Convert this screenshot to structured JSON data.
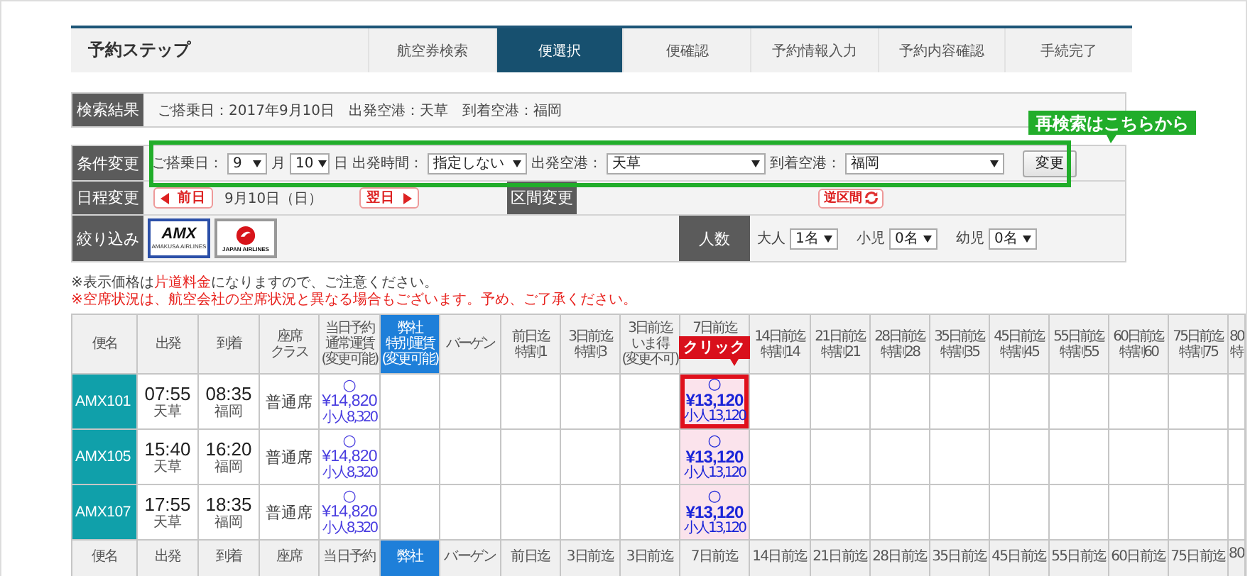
{
  "steps": {
    "title": "予約ステップ",
    "items": [
      {
        "label": "航空券検索",
        "selected": false
      },
      {
        "label": "便選択",
        "selected": true
      },
      {
        "label": "便確認",
        "selected": false
      },
      {
        "label": "予約情報入力",
        "selected": false
      },
      {
        "label": "予約内容確認",
        "selected": false
      },
      {
        "label": "手続完了",
        "selected": false
      }
    ]
  },
  "search_result": {
    "label": "検索結果",
    "text": "ご搭乗日：2017年9月10日　出発空港：天草　到着空港：福岡"
  },
  "conditions": {
    "label": "条件変更",
    "date_label": "ご搭乗日：",
    "month": "9",
    "month_unit": "月",
    "day": "10",
    "day_unit": "日",
    "time_label": "出発時間：",
    "time": "指定しない",
    "from_label": "出発空港：",
    "from": "天草",
    "to_label": "到着空港：",
    "to": "福岡",
    "button": "変更",
    "callout": "再検索はこちらから"
  },
  "schedule": {
    "label": "日程変更",
    "prev": "前日",
    "date": "9月10日（日）",
    "next": "翌日",
    "section_label": "区間変更",
    "reverse": "逆区間"
  },
  "filter": {
    "label": "絞り込み",
    "airlines": [
      {
        "kind": "amx",
        "name": "AMX",
        "subtitle": "AMAKUSA AIRLINES",
        "selected": true
      },
      {
        "kind": "jal",
        "subtitle": "JAPAN AIRLINES",
        "selected": false
      }
    ],
    "passengers_label": "人数",
    "passengers": [
      {
        "label": "大人",
        "value": "1名"
      },
      {
        "label": "小児",
        "value": "0名"
      },
      {
        "label": "幼児",
        "value": "0名"
      }
    ]
  },
  "notes": [
    {
      "parts": [
        {
          "text": "※表示価格は",
          "highlight": false
        },
        {
          "text": "片道料金",
          "highlight": true
        },
        {
          "text": "になりますので、ご注意ください。",
          "highlight": false
        }
      ]
    },
    {
      "parts": [
        {
          "text": "※空席状況は、航空会社の空席状況と異なる場合もございます。予め、ご了承ください。",
          "highlight": true
        }
      ]
    }
  ],
  "table": {
    "columns": [
      {
        "lines": [
          "便名"
        ],
        "kind": "plain"
      },
      {
        "lines": [
          "出発"
        ],
        "kind": "plain"
      },
      {
        "lines": [
          "到着"
        ],
        "kind": "plain"
      },
      {
        "lines": [
          "座席",
          "クラス"
        ],
        "kind": "plain"
      },
      {
        "lines": [
          "当日予約",
          "通常運賃",
          "(変更可能)"
        ],
        "kind": "plain"
      },
      {
        "lines": [
          "弊社",
          "特別運賃",
          "(変更可能)"
        ],
        "kind": "special"
      },
      {
        "lines": [
          "バーゲン"
        ],
        "kind": "plain"
      },
      {
        "lines": [
          "前日迄",
          "特割1"
        ],
        "kind": "plain"
      },
      {
        "lines": [
          "3日前迄",
          "特割3"
        ],
        "kind": "plain"
      },
      {
        "lines": [
          "3日前迄",
          "いま得",
          "(変更不可)"
        ],
        "kind": "plain"
      },
      {
        "lines": [
          "7日前迄"
        ],
        "kind": "plain"
      },
      {
        "lines": [
          "14日前迄",
          "特割14"
        ],
        "kind": "plain"
      },
      {
        "lines": [
          "21日前迄",
          "特割21"
        ],
        "kind": "plain"
      },
      {
        "lines": [
          "28日前迄",
          "特割28"
        ],
        "kind": "plain"
      },
      {
        "lines": [
          "35日前迄",
          "特割35"
        ],
        "kind": "plain"
      },
      {
        "lines": [
          "45日前迄",
          "特割45"
        ],
        "kind": "plain"
      },
      {
        "lines": [
          "55日前迄",
          "特割55"
        ],
        "kind": "plain"
      },
      {
        "lines": [
          "60日前迄",
          "特割60"
        ],
        "kind": "plain"
      },
      {
        "lines": [
          "75日前迄",
          "特割75"
        ],
        "kind": "plain"
      },
      {
        "lines": [
          "80",
          "特"
        ],
        "kind": "plain"
      }
    ],
    "callout": "クリック",
    "rows": [
      {
        "flight": "AMX101",
        "departure": {
          "time": "07:55",
          "airport": "天草"
        },
        "arrival": {
          "time": "08:35",
          "airport": "福岡"
        },
        "seat_class": "普通席",
        "fares": [
          {
            "kind": "fare",
            "mark": "○",
            "price": "¥14,820",
            "child": "小人8,320",
            "highlighted": false,
            "pointed": false
          },
          {
            "kind": "empty"
          },
          {
            "kind": "empty"
          },
          {
            "kind": "empty"
          },
          {
            "kind": "empty"
          },
          {
            "kind": "empty"
          },
          {
            "kind": "fare",
            "mark": "○",
            "price": "¥13,120",
            "child": "小人13,120",
            "highlighted": true,
            "pointed": true
          },
          {
            "kind": "empty"
          },
          {
            "kind": "empty"
          },
          {
            "kind": "empty"
          },
          {
            "kind": "empty"
          },
          {
            "kind": "empty"
          },
          {
            "kind": "empty"
          },
          {
            "kind": "empty"
          },
          {
            "kind": "empty"
          },
          {
            "kind": "empty"
          }
        ]
      },
      {
        "flight": "AMX105",
        "departure": {
          "time": "15:40",
          "airport": "天草"
        },
        "arrival": {
          "time": "16:20",
          "airport": "福岡"
        },
        "seat_class": "普通席",
        "fares": [
          {
            "kind": "fare",
            "mark": "○",
            "price": "¥14,820",
            "child": "小人8,320",
            "highlighted": false,
            "pointed": false
          },
          {
            "kind": "empty"
          },
          {
            "kind": "empty"
          },
          {
            "kind": "empty"
          },
          {
            "kind": "empty"
          },
          {
            "kind": "empty"
          },
          {
            "kind": "fare",
            "mark": "○",
            "price": "¥13,120",
            "child": "小人13,120",
            "highlighted": true,
            "pointed": false
          },
          {
            "kind": "empty"
          },
          {
            "kind": "empty"
          },
          {
            "kind": "empty"
          },
          {
            "kind": "empty"
          },
          {
            "kind": "empty"
          },
          {
            "kind": "empty"
          },
          {
            "kind": "empty"
          },
          {
            "kind": "empty"
          },
          {
            "kind": "empty"
          }
        ]
      },
      {
        "flight": "AMX107",
        "departure": {
          "time": "17:55",
          "airport": "天草"
        },
        "arrival": {
          "time": "18:35",
          "airport": "福岡"
        },
        "seat_class": "普通席",
        "fares": [
          {
            "kind": "fare",
            "mark": "○",
            "price": "¥14,820",
            "child": "小人8,320",
            "highlighted": false,
            "pointed": false
          },
          {
            "kind": "empty"
          },
          {
            "kind": "empty"
          },
          {
            "kind": "empty"
          },
          {
            "kind": "empty"
          },
          {
            "kind": "empty"
          },
          {
            "kind": "fare",
            "mark": "○",
            "price": "¥13,120",
            "child": "小人13,120",
            "highlighted": true,
            "pointed": false
          },
          {
            "kind": "empty"
          },
          {
            "kind": "empty"
          },
          {
            "kind": "empty"
          },
          {
            "kind": "empty"
          },
          {
            "kind": "empty"
          },
          {
            "kind": "empty"
          },
          {
            "kind": "empty"
          },
          {
            "kind": "empty"
          },
          {
            "kind": "empty"
          }
        ]
      }
    ],
    "repeated_header": [
      {
        "text": "便名",
        "kind": "plain"
      },
      {
        "text": "出発",
        "kind": "plain"
      },
      {
        "text": "到着",
        "kind": "plain"
      },
      {
        "text": "座席",
        "kind": "plain"
      },
      {
        "text": "当日予約",
        "kind": "plain"
      },
      {
        "text": "弊社",
        "kind": "special"
      },
      {
        "text": "バーゲン",
        "kind": "plain"
      },
      {
        "text": "前日迄",
        "kind": "plain"
      },
      {
        "text": "3日前迄",
        "kind": "plain"
      },
      {
        "text": "3日前迄",
        "kind": "plain"
      },
      {
        "text": "7日前迄",
        "kind": "plain"
      },
      {
        "text": "14日前迄",
        "kind": "plain"
      },
      {
        "text": "21日前迄",
        "kind": "plain"
      },
      {
        "text": "28日前迄",
        "kind": "plain"
      },
      {
        "text": "35日前迄",
        "kind": "plain"
      },
      {
        "text": "45日前迄",
        "kind": "plain"
      },
      {
        "text": "55日前迄",
        "kind": "plain"
      },
      {
        "text": "60日前迄",
        "kind": "plain"
      },
      {
        "text": "75日前迄",
        "kind": "plain"
      },
      {
        "text": "80",
        "kind": "plain"
      }
    ]
  }
}
